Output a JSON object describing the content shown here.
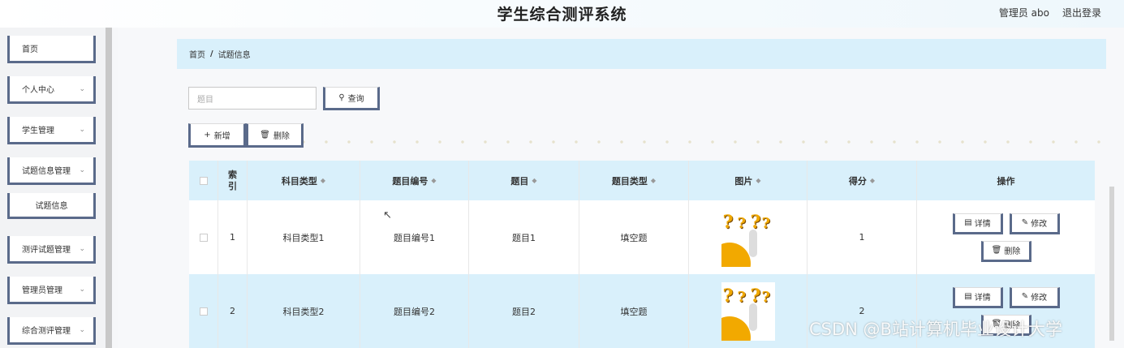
{
  "header": {
    "title": "学生综合测评系统",
    "user": "管理员 abo",
    "logout": "退出登录"
  },
  "sidebar": {
    "items": [
      {
        "label": "首页",
        "has_chevron": false
      },
      {
        "label": "个人中心",
        "has_chevron": true
      },
      {
        "label": "学生管理",
        "has_chevron": true
      },
      {
        "label": "试题信息管理",
        "has_chevron": true
      },
      {
        "label": "试题信息",
        "has_chevron": false
      },
      {
        "label": "测评试题管理",
        "has_chevron": true
      },
      {
        "label": "管理员管理",
        "has_chevron": true
      },
      {
        "label": "综合测评管理",
        "has_chevron": true
      }
    ]
  },
  "breadcrumb": {
    "home": "首页",
    "separator": "/",
    "current": "试题信息"
  },
  "search": {
    "placeholder": "题目",
    "button": "查询"
  },
  "actions": {
    "add": "新增",
    "delete": "删除"
  },
  "table": {
    "headers": [
      "索引",
      "科目类型",
      "题目编号",
      "题目",
      "题目类型",
      "图片",
      "得分",
      "操作"
    ],
    "rows": [
      {
        "index": "1",
        "subject_type": "科目类型1",
        "question_no": "题目编号1",
        "question": "题目1",
        "question_type": "填空题",
        "score": "1"
      },
      {
        "index": "2",
        "subject_type": "科目类型2",
        "question_no": "题目编号2",
        "question": "题目2",
        "question_type": "填空题",
        "score": "2"
      }
    ],
    "row_actions": {
      "detail": "详情",
      "edit": "修改",
      "delete": "删除"
    }
  },
  "watermark": "CSDN @B站计算机毕业设计大学",
  "colors": {
    "accent_bg": "#d9f0fb",
    "button_border": "#5a6a8a"
  }
}
